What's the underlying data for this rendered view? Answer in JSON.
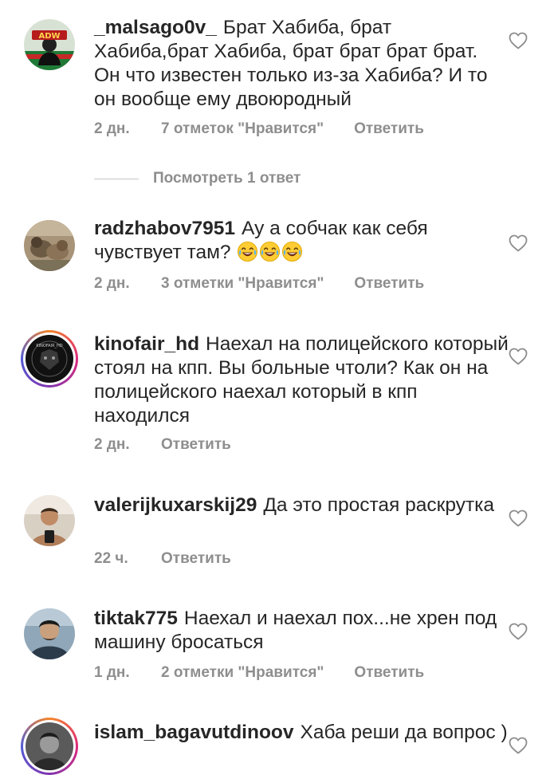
{
  "comments": [
    {
      "username": "_malsago0v_",
      "text": "Брат Хабиба, брат Хабиба,брат Хабиба, брат брат брат брат. Он что известен только из-за Хабиба? И то он вообще ему двоюродный",
      "time": "2 дн.",
      "likes": "7 отметок \"Нравится\"",
      "reply": "Ответить",
      "avatar_icon": "adw-logo-avatar"
    },
    {
      "username": "radzhabov7951",
      "text": "Ау а собчак как себя чувствует там?",
      "emoji": [
        "😂",
        "😂",
        "😂"
      ],
      "time": "2 дн.",
      "likes": "3 отметки \"Нравится\"",
      "reply": "Ответить",
      "avatar_icon": "cat-photo-avatar"
    },
    {
      "username": "kinofair_hd",
      "text": "Наехал на полицейского который стоял на кпп. Вы больные чтоли? Как он на полицейского наехал который в кпп находился",
      "time": "2 дн.",
      "reply": "Ответить",
      "avatar_icon": "kinofair-logo-avatar",
      "avatar_text": "KINOFAIR_HD"
    },
    {
      "username": "valerijkuxarskij29",
      "text": "Да это простая раскрутка",
      "time": "22 ч.",
      "reply": "Ответить",
      "avatar_icon": "person-photo-avatar"
    },
    {
      "username": "tiktak775",
      "text": "Наехал и наехал пох...не хрен под машину бросаться",
      "time": "1 дн.",
      "likes": "2 отметки \"Нравится\"",
      "reply": "Ответить",
      "avatar_icon": "person-photo-avatar"
    },
    {
      "username": "islam_bagavutdinoov",
      "text": "Хаба реши да вопрос )",
      "avatar_icon": "person-photo-avatar"
    }
  ],
  "replies_link": "Посмотреть 1 ответ",
  "icons": {
    "like": "heart-outline-icon"
  },
  "colors": {
    "text": "#262626",
    "secondary": "#8e8e8e",
    "divider": "#c7c7c7"
  }
}
